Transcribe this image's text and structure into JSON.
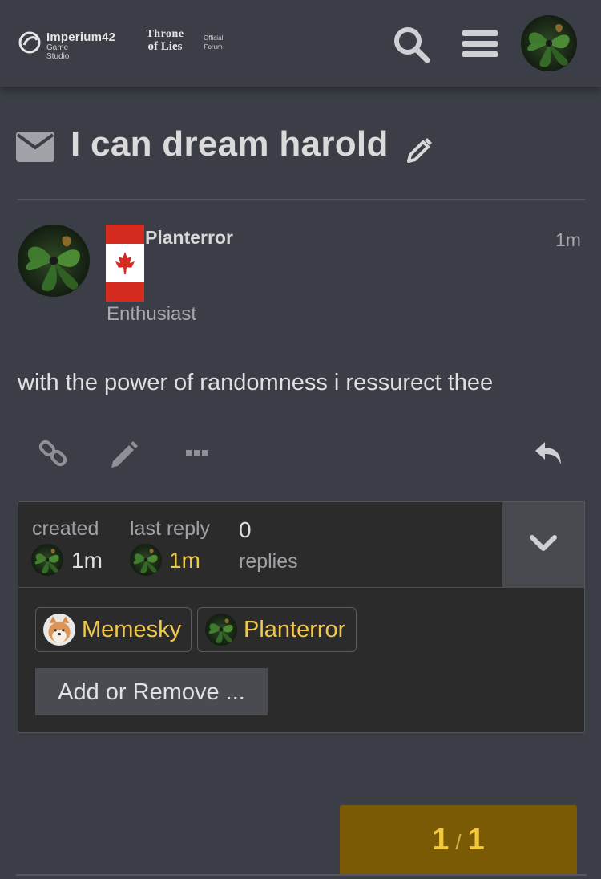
{
  "header": {
    "logo_brand": "Imperium42",
    "logo_studio": "Game Studio",
    "logo_game_line1": "Throne",
    "logo_game_line2": "of Lies",
    "logo_forum_line1": "Official",
    "logo_forum_line2": "Forum",
    "search_icon": "search-icon",
    "menu_icon": "hamburger-menu-icon"
  },
  "topic": {
    "title": "I can dream harold",
    "type_icon": "envelope-icon"
  },
  "post": {
    "username": "Planterror",
    "user_title": "Enthusiast",
    "time": "1m",
    "body": "with the power of randomness i ressurect thee",
    "flag": "canada-flag"
  },
  "topic_map": {
    "created_label": "created",
    "created_value": "1m",
    "last_reply_label": "last reply",
    "last_reply_value": "1m",
    "replies_count": "0",
    "replies_label": "replies",
    "participants": [
      {
        "name": "Memesky"
      },
      {
        "name": "Planterror"
      }
    ],
    "add_remove_label": "Add or Remove ..."
  },
  "progress": {
    "current": "1",
    "separator": "/",
    "total": "1"
  },
  "colors": {
    "background": "#3b3e46",
    "accent_yellow": "#f0c94a",
    "progress_bg": "#7a5a05"
  }
}
